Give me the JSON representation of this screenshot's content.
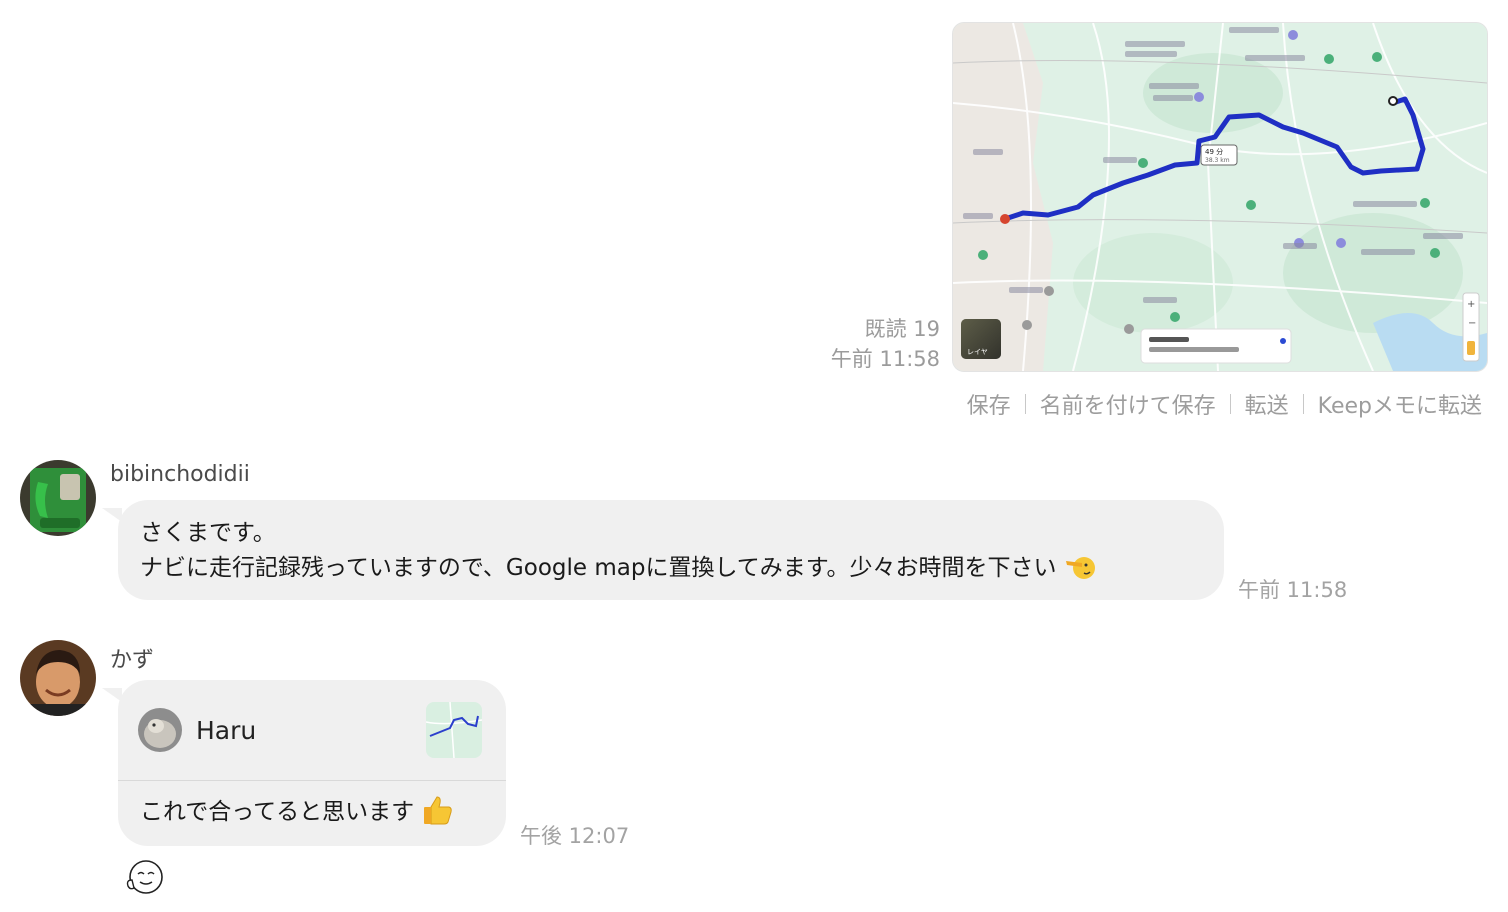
{
  "outgoing": {
    "read_status": "既読 19",
    "time": "午前 11:58",
    "map_labels": {
      "duration": "49 分",
      "distance": "38.3 km",
      "layers": "レイヤ"
    }
  },
  "actions": {
    "save": "保存",
    "save_as": "名前を付けて保存",
    "forward": "転送",
    "keep": "Keepメモに転送"
  },
  "messages": [
    {
      "sender": "bibinchodidii",
      "line1": "さくまです。",
      "line2": "ナビに走行記録残っていますので、Google mapに置換してみます。少々お時間を下さい",
      "time": "午前 11:58"
    },
    {
      "sender": "かず",
      "quoted_name": "Haru",
      "text": "これで合ってると思います",
      "time": "午後 12:07"
    }
  ],
  "colors": {
    "bubble": "#f0f0f0",
    "route": "#1f2fc4",
    "meta_text": "#9b9b9b"
  },
  "icons": {
    "reaction": "thinking-face-sticker",
    "pointing_emoji": "point-left-emoji",
    "thumbs_up_emoji": "thumbs-up-emoji"
  }
}
